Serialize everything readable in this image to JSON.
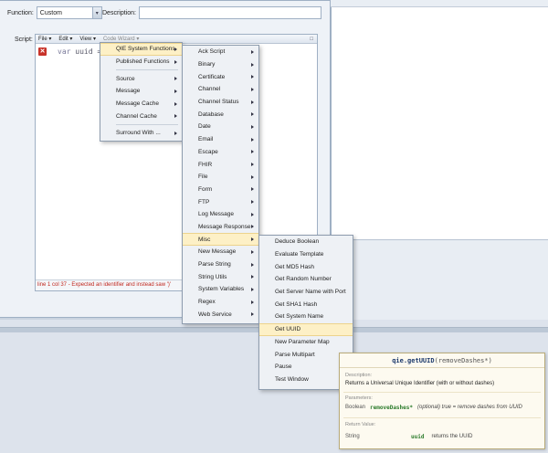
{
  "form": {
    "function_label": "Function:",
    "function_value": "Custom",
    "description_label": "Description:",
    "description_value": "",
    "script_label": "Script:"
  },
  "script_toolbar": {
    "file": "File ▾",
    "edit": "Edit ▾",
    "view": "View ▾",
    "code_wizard": "Code Wizard ▾",
    "maximize_glyph": "□"
  },
  "editor": {
    "code_keyword": "var",
    "code_rest": "uuid =",
    "error_glyph": "✕",
    "status_message": "line 1 col 37 - Expected an identifier and instead saw ')'"
  },
  "menu1": {
    "items": [
      "QIE System Functions",
      "Published Functions",
      "Source",
      "Message",
      "Message Cache",
      "Channel Cache",
      "Surround With ..."
    ]
  },
  "menu2": {
    "items": [
      "Ack Script",
      "Binary",
      "Certificate",
      "Channel",
      "Channel Status",
      "Database",
      "Date",
      "Email",
      "Escape",
      "FHIR",
      "File",
      "Form",
      "FTP",
      "Log Message",
      "Message Response",
      "Misc",
      "New Message",
      "Parse String",
      "String Utils",
      "System Variables",
      "Regex",
      "Web Service"
    ]
  },
  "menu3": {
    "items": [
      "Deduce Boolean",
      "Evaluate Template",
      "Get MD5 Hash",
      "Get Random Number",
      "Get Server Name with Port",
      "Get SHA1 Hash",
      "Get System Name",
      "Get UUID",
      "New Parameter Map",
      "Parse Multipart",
      "Pause",
      "Test Window"
    ]
  },
  "tooltip": {
    "signature_fn": "qie.getUUID",
    "signature_args": "(removeDashes*)",
    "description_heading": "Description:",
    "description": "Returns a Universal Unique Identifier (with or without dashes)",
    "parameters_heading": "Parameters:",
    "param_type": "Boolean",
    "param_name": "removeDashes*",
    "param_desc": "(optional) true = remove dashes from UUID",
    "return_heading": "Return Value:",
    "return_type": "String",
    "return_name": "uuid",
    "return_desc": "returns the UUID"
  }
}
